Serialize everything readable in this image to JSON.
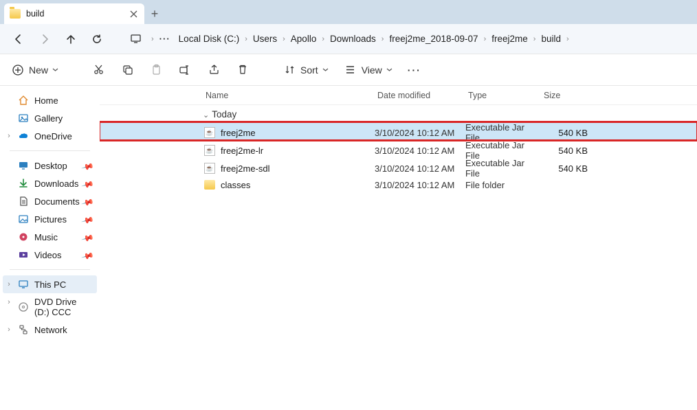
{
  "tab": {
    "title": "build"
  },
  "breadcrumb": {
    "items": [
      "Local Disk (C:)",
      "Users",
      "Apollo",
      "Downloads",
      "freej2me_2018-09-07",
      "freej2me",
      "build"
    ]
  },
  "toolbar": {
    "new_label": "New",
    "sort_label": "Sort",
    "view_label": "View"
  },
  "sidebar": {
    "top": [
      {
        "label": "Home"
      },
      {
        "label": "Gallery"
      },
      {
        "label": "OneDrive",
        "caret": true
      }
    ],
    "quick": [
      {
        "label": "Desktop",
        "pin": true
      },
      {
        "label": "Downloads",
        "pin": true
      },
      {
        "label": "Documents",
        "pin": true
      },
      {
        "label": "Pictures",
        "pin": true
      },
      {
        "label": "Music",
        "pin": true
      },
      {
        "label": "Videos",
        "pin": true
      }
    ],
    "system": [
      {
        "label": "This PC",
        "caret": true,
        "selected": true
      },
      {
        "label": "DVD Drive (D:) CCC",
        "caret": true
      },
      {
        "label": "Network",
        "caret": true
      }
    ]
  },
  "columns": {
    "name": "Name",
    "date": "Date modified",
    "type": "Type",
    "size": "Size"
  },
  "group": "Today",
  "files": [
    {
      "name": "freej2me",
      "date": "3/10/2024 10:12 AM",
      "type": "Executable Jar File",
      "size": "540 KB",
      "kind": "jar",
      "selected": true
    },
    {
      "name": "freej2me-lr",
      "date": "3/10/2024 10:12 AM",
      "type": "Executable Jar File",
      "size": "540 KB",
      "kind": "jar"
    },
    {
      "name": "freej2me-sdl",
      "date": "3/10/2024 10:12 AM",
      "type": "Executable Jar File",
      "size": "540 KB",
      "kind": "jar"
    },
    {
      "name": "classes",
      "date": "3/10/2024 10:12 AM",
      "type": "File folder",
      "size": "",
      "kind": "folder"
    }
  ]
}
